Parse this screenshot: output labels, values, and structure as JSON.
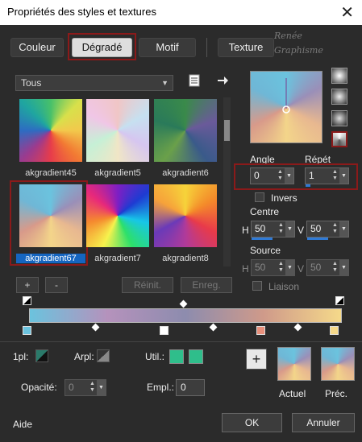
{
  "window": {
    "title": "Propriétés des styles et textures",
    "close_glyph": "✕"
  },
  "tabs": [
    {
      "label": "Couleur"
    },
    {
      "label": "Dégradé"
    },
    {
      "label": "Motif"
    },
    {
      "label": "Texture"
    }
  ],
  "watermark": {
    "line1": "Renée",
    "line2": "Graphisme"
  },
  "category": {
    "selected": "Tous"
  },
  "gradients": [
    {
      "name": "akgradient45"
    },
    {
      "name": "akgradient5"
    },
    {
      "name": "akgradient6"
    },
    {
      "name": "akgradient67"
    },
    {
      "name": "akgradient7"
    },
    {
      "name": "akgradient8"
    }
  ],
  "buttons": {
    "add": "+",
    "remove": "-",
    "reset": "Réinit.",
    "save": "Enreg."
  },
  "angle": {
    "label": "Angle",
    "value": "0"
  },
  "repeat": {
    "label": "Répét",
    "value": "1"
  },
  "invert": {
    "label": "Invers"
  },
  "center": {
    "label": "Centre",
    "h_label": "H",
    "h_value": "50",
    "v_label": "V",
    "v_value": "50"
  },
  "source": {
    "label": "Source",
    "h_label": "H",
    "h_value": "50",
    "v_label": "V",
    "v_value": "50"
  },
  "link": {
    "label": "Liaison"
  },
  "stops": {
    "colors": [
      "#6bc3de",
      "#ffffff",
      "#e8907c",
      "#f5d98a"
    ],
    "gradient_colors": [
      "#6bc3de",
      "#b592bc",
      "#8d8cae",
      "#cf9a8a",
      "#f5d98a"
    ]
  },
  "bottom": {
    "mode1_label": "1pl:",
    "mode2_label": "Arpl:",
    "util_label": "Util.:",
    "util_color": "#2fbe8b",
    "opacity_label": "Opacité:",
    "opacity_value": "0",
    "empl_label": "Empl.:",
    "empl_value": "0",
    "add_glyph": "+",
    "current_label": "Actuel",
    "prev_label": "Préc."
  },
  "footer": {
    "help": "Aide",
    "ok": "OK",
    "cancel": "Annuler"
  }
}
